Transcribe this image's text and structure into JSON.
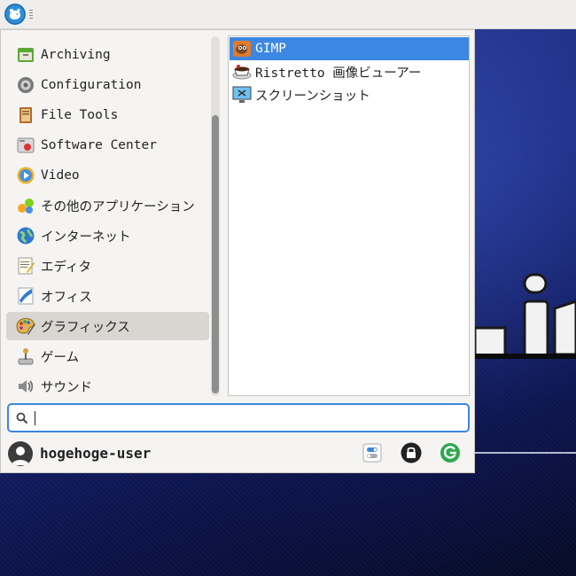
{
  "panel": {
    "menu_button_icon": "xfce-mouse-icon"
  },
  "categories": [
    {
      "label": "Archiving",
      "icon": "archive-icon",
      "selected": false
    },
    {
      "label": "Configuration",
      "icon": "settings-icon",
      "selected": false
    },
    {
      "label": "File Tools",
      "icon": "file-tools-icon",
      "selected": false
    },
    {
      "label": "Software Center",
      "icon": "software-center-icon",
      "selected": false
    },
    {
      "label": "Video",
      "icon": "video-icon",
      "selected": false
    },
    {
      "label": "その他のアプリケーション",
      "icon": "other-apps-icon",
      "selected": false
    },
    {
      "label": "インターネット",
      "icon": "internet-icon",
      "selected": false
    },
    {
      "label": "エディタ",
      "icon": "editor-icon",
      "selected": false
    },
    {
      "label": "オフィス",
      "icon": "office-icon",
      "selected": false
    },
    {
      "label": "グラフィックス",
      "icon": "graphics-icon",
      "selected": true
    },
    {
      "label": "ゲーム",
      "icon": "games-icon",
      "selected": false
    },
    {
      "label": "サウンド",
      "icon": "sound-icon",
      "selected": false
    }
  ],
  "apps": [
    {
      "label": "GIMP",
      "icon": "gimp-icon",
      "selected": true
    },
    {
      "label": "Ristretto 画像ビューアー",
      "icon": "ristretto-icon",
      "selected": false
    },
    {
      "label": "スクリーンショット",
      "icon": "screenshot-icon",
      "selected": false
    }
  ],
  "search": {
    "value": "",
    "placeholder": ""
  },
  "user": {
    "name": "hogehoge-user"
  },
  "actions": [
    {
      "name": "settings-toggle",
      "icon": "settings-toggle-icon"
    },
    {
      "name": "lock-screen",
      "icon": "lock-icon"
    },
    {
      "name": "logout",
      "icon": "logout-icon"
    }
  ],
  "colors": {
    "selection": "#3c87e2",
    "category_selection": "#d9d6d2",
    "logout_green": "#2fa84f"
  }
}
